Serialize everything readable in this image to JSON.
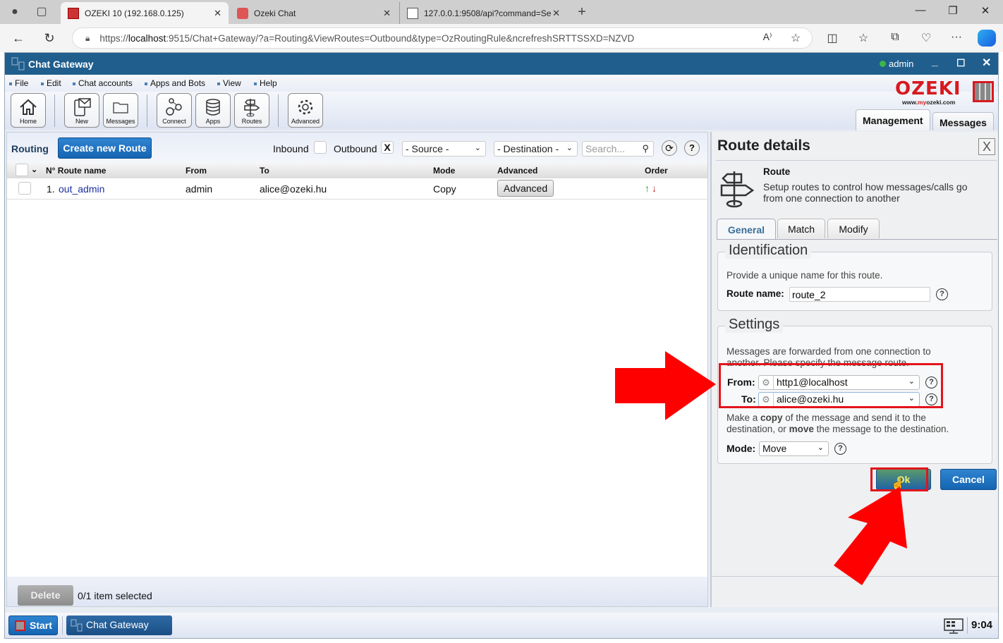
{
  "browser": {
    "tabs": [
      {
        "title": "OZEKI 10 (192.168.0.125)",
        "active": true
      },
      {
        "title": "Ozeki Chat",
        "active": false
      },
      {
        "title": "127.0.0.1:9508/api?command=Se",
        "active": false
      }
    ],
    "url_prefix": "https://",
    "url_host": "localhost",
    "url_rest": ":9515/Chat+Gateway/?a=Routing&ViewRoutes=Outbound&type=OzRoutingRule&ncrefreshSRTTSSXD=NZVD"
  },
  "app": {
    "title": "Chat Gateway",
    "user": "admin",
    "menu": [
      "File",
      "Edit",
      "Chat accounts",
      "Apps and Bots",
      "View",
      "Help"
    ],
    "toolbar": [
      {
        "label": "Home",
        "icon": "home-icon"
      },
      {
        "label": "New",
        "icon": "new-message-icon"
      },
      {
        "label": "Messages",
        "icon": "folder-icon"
      },
      {
        "label": "Connect",
        "icon": "connect-icon"
      },
      {
        "label": "Apps",
        "icon": "database-icon"
      },
      {
        "label": "Routes",
        "icon": "signpost-icon"
      },
      {
        "label": "Advanced",
        "icon": "gear-icon"
      }
    ],
    "logo_text": "OZEKI",
    "logo_url_pre": "www.",
    "logo_url_my": "my",
    "logo_url_post": "ozeki.com",
    "right_tabs": [
      "Management",
      "Messages"
    ]
  },
  "routing": {
    "label": "Routing",
    "create_button": "Create new Route",
    "inbound_label": "Inbound",
    "outbound_label": "Outbound",
    "outbound_mark": "X",
    "source_select": "- Source -",
    "destination_select": "- Destination -",
    "search_placeholder": "Search...",
    "columns": [
      "N° Route name",
      "From",
      "To",
      "Mode",
      "Advanced",
      "Order"
    ],
    "rows": [
      {
        "num": "1.",
        "name": "out_admin",
        "from": "admin",
        "to": "alice@ozeki.hu",
        "mode": "Copy",
        "advanced": "Advanced"
      }
    ],
    "delete_button": "Delete",
    "selection_status": "0/1 item selected"
  },
  "details": {
    "title": "Route details",
    "close": "X",
    "heading": "Route",
    "description": "Setup routes to control how messages/calls go from one connection to another",
    "tabs": [
      "General",
      "Match",
      "Modify"
    ],
    "identification": {
      "legend": "Identification",
      "text": "Provide a unique name for this route.",
      "name_label": "Route name:",
      "name_value": "route_2"
    },
    "settings": {
      "legend": "Settings",
      "text": "Messages are forwarded from one connection to another. Please specify the message route.",
      "from_label": "From:",
      "from_value": "http1@localhost",
      "to_label": "To:",
      "to_value": "alice@ozeki.hu",
      "mode_text_1": "Make a ",
      "mode_text_copy": "copy",
      "mode_text_2": " of the message and send it to the destination, or ",
      "mode_text_move": "move",
      "mode_text_3": " the message to the destination.",
      "mode_label": "Mode:",
      "mode_value": "Move"
    },
    "ok_button": "Ok",
    "cancel_button": "Cancel"
  },
  "taskbar": {
    "start": "Start",
    "app": "Chat Gateway",
    "clock": "9:04"
  },
  "colors": {
    "titlebar": "#1f5e8d",
    "accent_blue": "#1565b2",
    "highlight_red": "#e3141b",
    "logo_red": "#d7191f"
  }
}
